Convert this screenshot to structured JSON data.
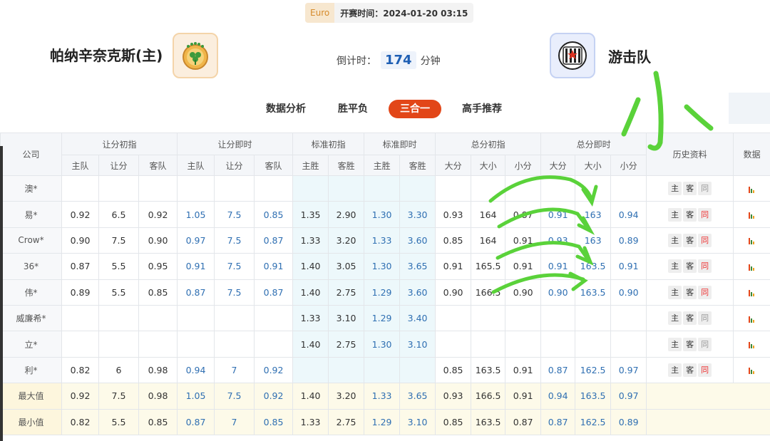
{
  "header": {
    "league": "Euro",
    "kickoff_label": "开赛时间：",
    "kickoff_time": "2024-01-20 03:15",
    "home_team": "帕纳辛奈克斯(主)",
    "away_team": "游击队",
    "countdown_label": "倒计时：",
    "countdown_value": "174",
    "countdown_unit": "分钟"
  },
  "tabs": [
    {
      "label": "数据分析",
      "active": false
    },
    {
      "label": "胜平负",
      "active": false
    },
    {
      "label": "三合一",
      "active": true
    },
    {
      "label": "高手推荐",
      "active": false
    }
  ],
  "table": {
    "company_header": "公司",
    "group_headers": [
      "让分初指",
      "让分即时",
      "标准初指",
      "标准即时",
      "总分初指",
      "总分即时"
    ],
    "history_header": "历史资料",
    "data_header": "数据",
    "sub_headers": [
      "主队",
      "让分",
      "客队",
      "主队",
      "让分",
      "客队",
      "主胜",
      "客胜",
      "主胜",
      "客胜",
      "大分",
      "大小",
      "小分",
      "大分",
      "大小",
      "小分"
    ],
    "history_buttons": [
      "主",
      "客",
      "同"
    ],
    "rows": [
      {
        "company": "澳*",
        "cells": [
          "",
          "",
          "",
          "",
          "",
          "",
          "",
          "",
          "",
          "",
          "",
          "",
          "",
          "",
          "",
          ""
        ],
        "same_red": false
      },
      {
        "company": "易*",
        "cells": [
          "0.92",
          "6.5",
          "0.92",
          "1.05",
          "7.5",
          "0.85",
          "1.35",
          "2.90",
          "1.30",
          "3.30",
          "0.93",
          "164",
          "0.87",
          "0.91",
          "163",
          "0.94"
        ],
        "same_red": true
      },
      {
        "company": "Crow*",
        "cells": [
          "0.90",
          "7.5",
          "0.90",
          "0.97",
          "7.5",
          "0.87",
          "1.33",
          "3.20",
          "1.33",
          "3.60",
          "0.85",
          "164",
          "0.91",
          "0.93",
          "163",
          "0.89"
        ],
        "same_red": true
      },
      {
        "company": "36*",
        "cells": [
          "0.87",
          "5.5",
          "0.95",
          "0.91",
          "7.5",
          "0.91",
          "1.40",
          "3.05",
          "1.30",
          "3.65",
          "0.91",
          "165.5",
          "0.91",
          "0.91",
          "163.5",
          "0.91"
        ],
        "same_red": true
      },
      {
        "company": "伟*",
        "cells": [
          "0.89",
          "5.5",
          "0.85",
          "0.87",
          "7.5",
          "0.87",
          "1.40",
          "2.75",
          "1.29",
          "3.60",
          "0.90",
          "166.5",
          "0.90",
          "0.90",
          "163.5",
          "0.90"
        ],
        "same_red": true
      },
      {
        "company": "威廉希*",
        "cells": [
          "",
          "",
          "",
          "",
          "",
          "",
          "1.33",
          "3.10",
          "1.29",
          "3.40",
          "",
          "",
          "",
          "",
          "",
          ""
        ],
        "same_red": false
      },
      {
        "company": "立*",
        "cells": [
          "",
          "",
          "",
          "",
          "",
          "",
          "1.40",
          "2.75",
          "1.30",
          "3.10",
          "",
          "",
          "",
          "",
          "",
          ""
        ],
        "same_red": false
      },
      {
        "company": "利*",
        "cells": [
          "0.82",
          "6",
          "0.98",
          "0.94",
          "7",
          "0.92",
          "",
          "",
          "",
          "",
          "0.85",
          "163.5",
          "0.91",
          "0.87",
          "162.5",
          "0.97"
        ],
        "same_red": true
      }
    ],
    "summary": [
      {
        "label": "最大值",
        "cells": [
          "0.92",
          "7.5",
          "0.98",
          "1.05",
          "7.5",
          "0.92",
          "1.40",
          "3.20",
          "1.33",
          "3.65",
          "0.93",
          "166.5",
          "0.91",
          "0.94",
          "163.5",
          "0.97"
        ]
      },
      {
        "label": "最小值",
        "cells": [
          "0.82",
          "5.5",
          "0.85",
          "0.87",
          "7",
          "0.85",
          "1.33",
          "2.75",
          "1.29",
          "3.10",
          "0.85",
          "163.5",
          "0.87",
          "0.87",
          "162.5",
          "0.89"
        ]
      }
    ]
  },
  "annotation": {
    "handwritten_text": "小",
    "ink_color": "#5ad23a"
  }
}
